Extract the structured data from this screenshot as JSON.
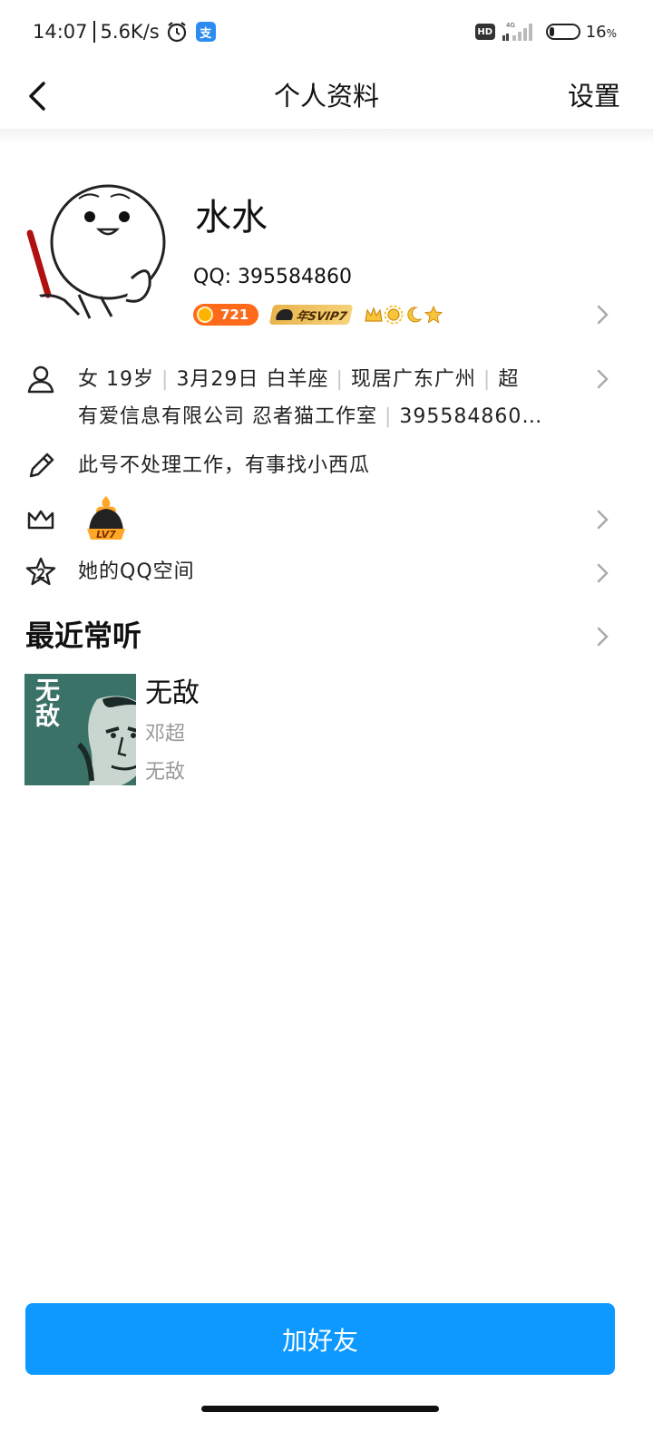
{
  "status_bar": {
    "time": "14:07",
    "net_speed": "5.6K/s",
    "app_icon_glyph": "支",
    "hd": "HD",
    "network": "4G",
    "battery_percent": "16",
    "battery_unit": "%",
    "battery_level": 0.16
  },
  "nav": {
    "title": "个人资料",
    "settings_label": "设置"
  },
  "profile": {
    "nickname": "水水",
    "qq_label": "QQ: 395584860",
    "coin_count": "721",
    "svip_label": "年SVIP7"
  },
  "info": {
    "gender": "女",
    "age": "19岁",
    "birthday": "3月29日",
    "zodiac": "白羊座",
    "location": "现居广东广州",
    "company_line1": "超",
    "company_line2": "有爱信息有限公司 忍者猫工作室",
    "extra": "395584860…",
    "signature": "此号不处理工作，有事找小西瓜",
    "qzone_label": "她的QQ空间",
    "lv_badge_text": "LV7"
  },
  "music": {
    "section_title": "最近常听",
    "cover_text": "无敌",
    "song_title": "无敌",
    "artist": "邓超",
    "album": "无敌"
  },
  "actions": {
    "add_friend_label": "加好友"
  },
  "colors": {
    "primary_button": "#0d99ff",
    "secondary_text": "#999999",
    "coin_badge": "#ff6a1a",
    "svip_gold": "#e8b44c"
  }
}
